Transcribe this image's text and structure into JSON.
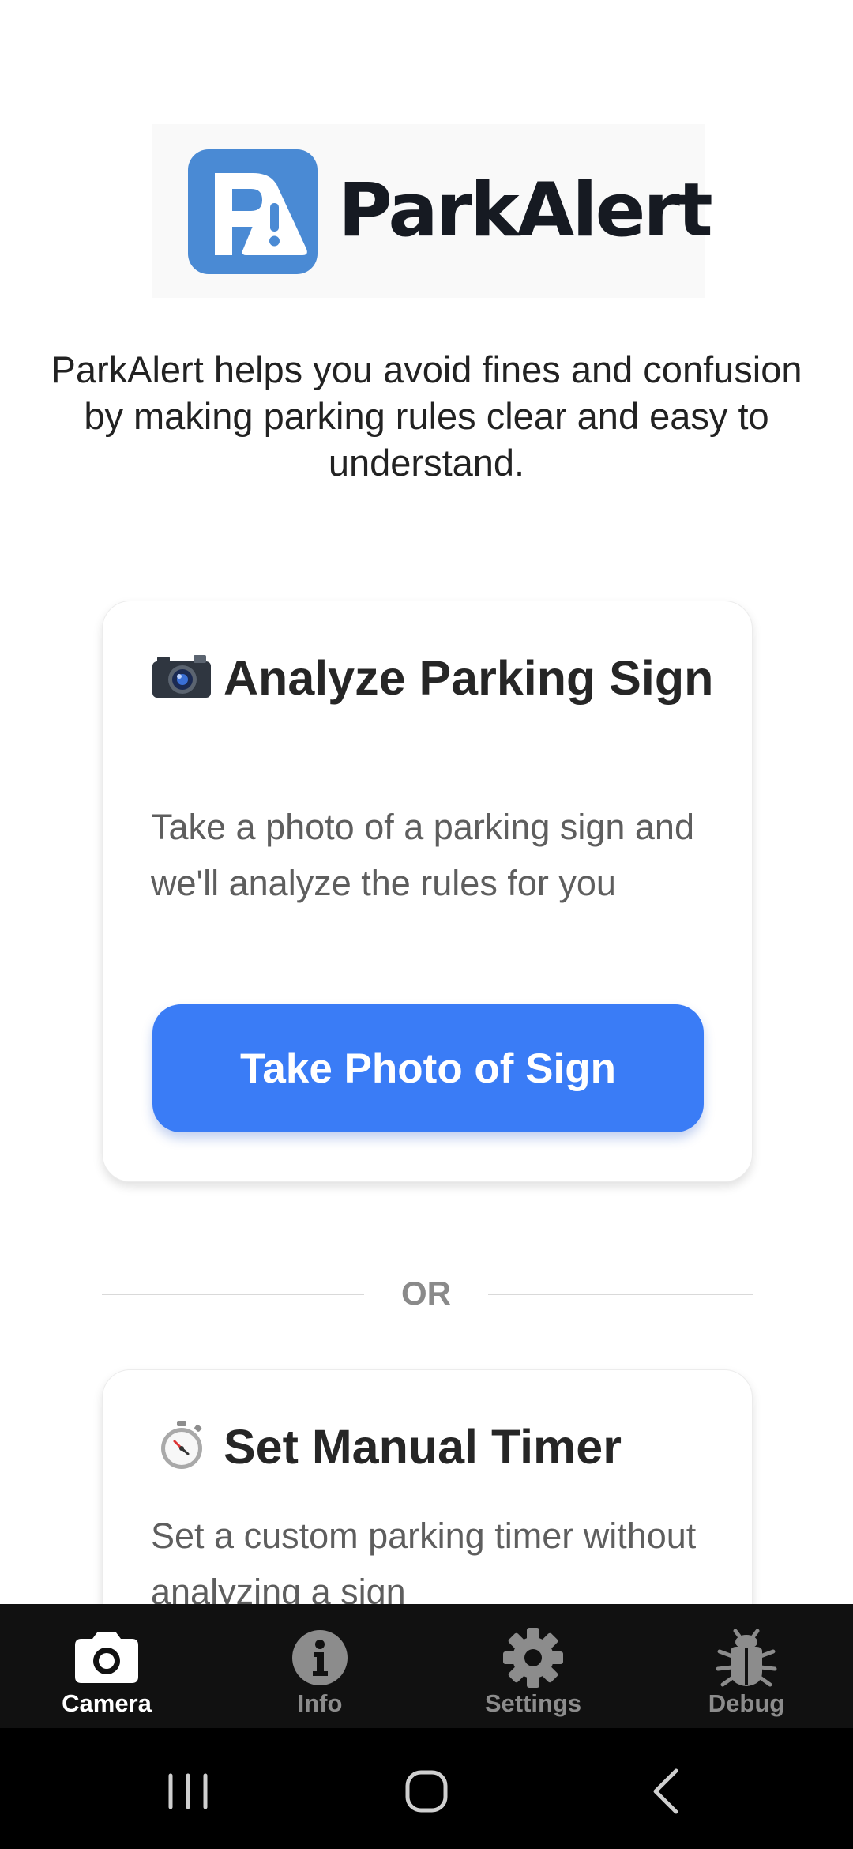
{
  "app": {
    "name": "ParkAlert",
    "tagline": "ParkAlert helps you avoid fines and confusion by making parking rules clear and easy to understand."
  },
  "colors": {
    "accent": "#3a7cf6",
    "logo_blue": "#4a8ad4",
    "tab_bar": "#111111",
    "tab_active": "#ffffff",
    "tab_inactive": "#8c8c8c"
  },
  "analyze_card": {
    "icon": "camera-emoji-icon",
    "title": "Analyze Parking Sign",
    "description": "Take a photo of a parking sign and we'll analyze the rules for you",
    "button_label": "Take Photo of Sign"
  },
  "divider": {
    "label": "OR"
  },
  "timer_card": {
    "icon": "stopwatch-emoji-icon",
    "title": "Set Manual Timer",
    "description": "Set a custom parking timer without analyzing a sign"
  },
  "tabs": [
    {
      "label": "Camera",
      "icon": "camera-icon",
      "active": true
    },
    {
      "label": "Info",
      "icon": "info-icon",
      "active": false
    },
    {
      "label": "Settings",
      "icon": "gear-icon",
      "active": false
    },
    {
      "label": "Debug",
      "icon": "bug-icon",
      "active": false
    }
  ],
  "system_nav": {
    "buttons": [
      "recent-apps-icon",
      "home-icon",
      "back-icon"
    ]
  }
}
